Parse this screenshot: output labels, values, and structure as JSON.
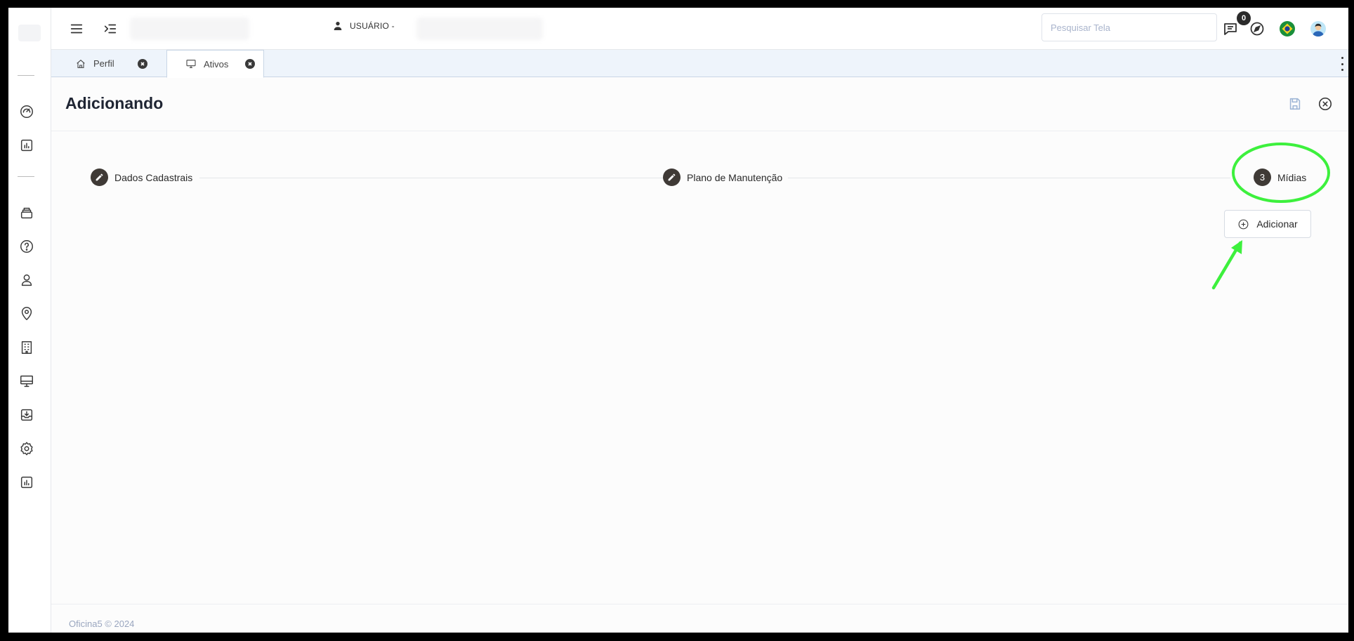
{
  "app": {
    "user_label": "USUÁRIO -",
    "search_placeholder": "Pesquisar Tela",
    "notification_count": "0"
  },
  "tabs": [
    {
      "label": "Perfil",
      "icon": "home-icon"
    },
    {
      "label": "Ativos",
      "icon": "monitor-icon",
      "active": true
    }
  ],
  "page": {
    "title": "Adicionando"
  },
  "steps": [
    {
      "label": "Dados Cadastrais",
      "status": "edit"
    },
    {
      "label": "Plano de Manutenção",
      "status": "edit"
    },
    {
      "label": "Mídias",
      "number": "3",
      "status": "current"
    }
  ],
  "actions": {
    "add_label": "Adicionar"
  },
  "footer": {
    "text": "Oficina5 © 2024"
  },
  "sidebar": {
    "icons": [
      "dashboard-icon",
      "chart-icon",
      "inventory-icon",
      "help-icon",
      "user-icon",
      "location-icon",
      "building-icon",
      "monitor-icon",
      "inbox-icon",
      "settings-icon",
      "report-icon"
    ]
  },
  "colors": {
    "annotation": "#3df03d",
    "step_dot": "#3f3a36",
    "title": "#1f2533",
    "save_icon": "#9fb6d6"
  }
}
